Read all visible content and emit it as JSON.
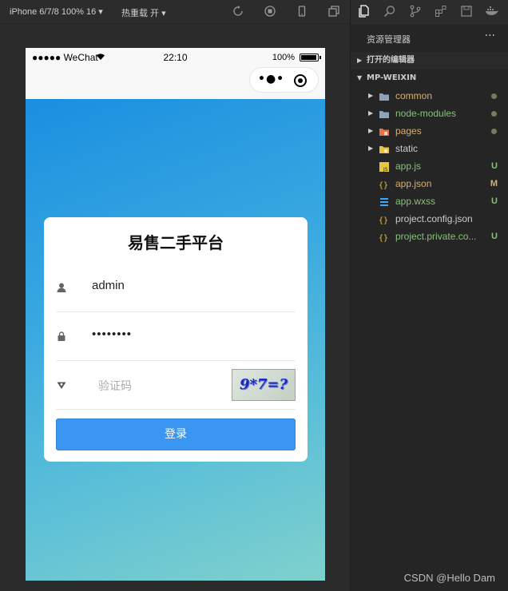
{
  "toolbar": {
    "device": "iPhone 6/7/8 100% 16 ▾",
    "hot_reload": "热重载 开 ▾",
    "icons": [
      "refresh-icon",
      "stop-icon",
      "phone-icon",
      "window-icon"
    ]
  },
  "phone": {
    "carrier": "●●●●● WeChat",
    "time": "22:10",
    "battery": "100%",
    "capsule_dots": "•●•"
  },
  "login": {
    "title": "易售二手平台",
    "username": "admin",
    "password": "••••••••",
    "captcha_placeholder": "验证码",
    "captcha_image_text": "9*7=?",
    "button": "登录"
  },
  "explorer": {
    "title": "资源管理器",
    "more": "···",
    "section_open_editors": "打开的编辑器",
    "section_project": "MP-WEIXIN",
    "items": [
      {
        "label": "common",
        "type": "folder",
        "status": "dot",
        "color": "#d7b070"
      },
      {
        "label": "node-modules",
        "type": "folder",
        "status": "dot",
        "color": "#89c07a"
      },
      {
        "label": "pages",
        "type": "folder-pages",
        "status": "dot",
        "color": "#d7b070"
      },
      {
        "label": "static",
        "type": "folder-static",
        "status": "",
        "color": "#cccccc"
      },
      {
        "label": "app.js",
        "type": "js",
        "status": "U",
        "color": "#89c07a"
      },
      {
        "label": "app.json",
        "type": "json",
        "status": "M",
        "color": "#d7b070"
      },
      {
        "label": "app.wxss",
        "type": "css",
        "status": "U",
        "color": "#89c07a"
      },
      {
        "label": "project.config.json",
        "type": "json",
        "status": "",
        "color": "#cccccc"
      },
      {
        "label": "project.private.co...",
        "type": "json",
        "status": "U",
        "color": "#89c07a"
      }
    ]
  },
  "watermark": "CSDN @Hello Dam"
}
